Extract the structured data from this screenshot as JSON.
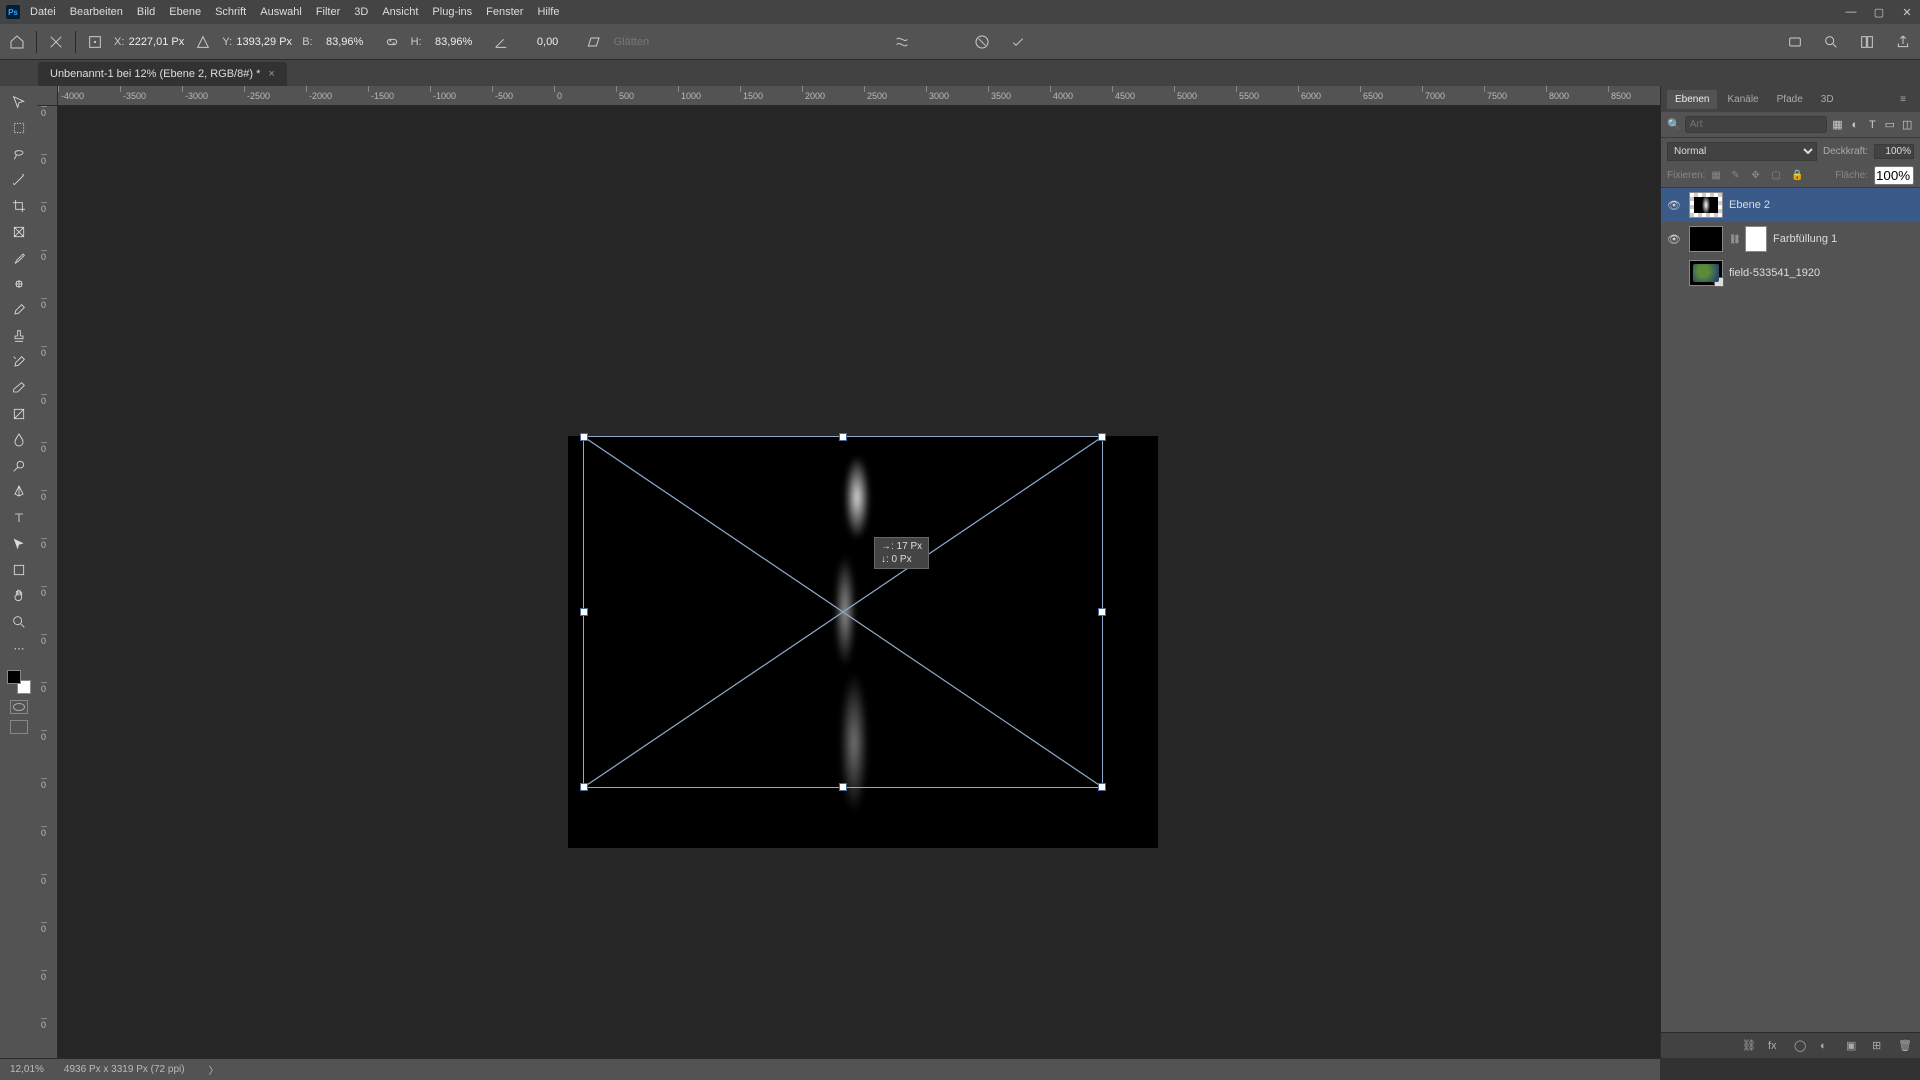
{
  "menu": {
    "items": [
      "Datei",
      "Bearbeiten",
      "Bild",
      "Ebene",
      "Schrift",
      "Auswahl",
      "Filter",
      "3D",
      "Ansicht",
      "Plug-ins",
      "Fenster",
      "Hilfe"
    ]
  },
  "options": {
    "x_label": "X:",
    "x_val": "2227,01 Px",
    "y_label": "Y:",
    "y_val": "1393,29 Px",
    "w_label": "B:",
    "w_val": "83,96%",
    "h_label": "H:",
    "h_val": "83,96%",
    "rot_val": "0,00",
    "glatten": "Glätten"
  },
  "doctab": {
    "title": "Unbenannt-1 bei 12% (Ebene 2, RGB/8#) *"
  },
  "ruler_h": [
    "-4000",
    "-3500",
    "-3000",
    "-2500",
    "-2000",
    "-1500",
    "-1000",
    "-500",
    "0",
    "500",
    "1000",
    "1500",
    "2000",
    "2500",
    "3000",
    "3500",
    "4000",
    "4500",
    "5000",
    "5500",
    "6000",
    "6500",
    "7000",
    "7500",
    "8000",
    "8500"
  ],
  "ruler_v": [
    "0",
    "0",
    "0",
    "0",
    "500",
    "1000",
    "1500",
    "2000",
    "2500",
    "3000",
    "3500"
  ],
  "tooltip": {
    "line1": "→: 17 Px",
    "line2": "↓:  0 Px"
  },
  "panel": {
    "tabs": [
      "Ebenen",
      "Kanäle",
      "Pfade",
      "3D"
    ],
    "search_ph": "Art",
    "blend": "Normal",
    "opacity_label": "Deckkraft:",
    "opacity_val": "100%",
    "lock_label": "Fixieren:",
    "fill_label": "Fläche:",
    "fill_val": "100%"
  },
  "layers": [
    {
      "name": "Ebene 2",
      "visible": true,
      "sel": true,
      "thumb": "checker"
    },
    {
      "name": "Farbfüllung 1",
      "visible": true,
      "sel": false,
      "thumb": "black",
      "mask": true,
      "link": true
    },
    {
      "name": "field-533541_1920",
      "visible": false,
      "sel": false,
      "thumb": "img",
      "smart": true
    }
  ],
  "status": {
    "zoom": "12,01%",
    "info": "4936 Px x 3319 Px (72 ppi)"
  }
}
